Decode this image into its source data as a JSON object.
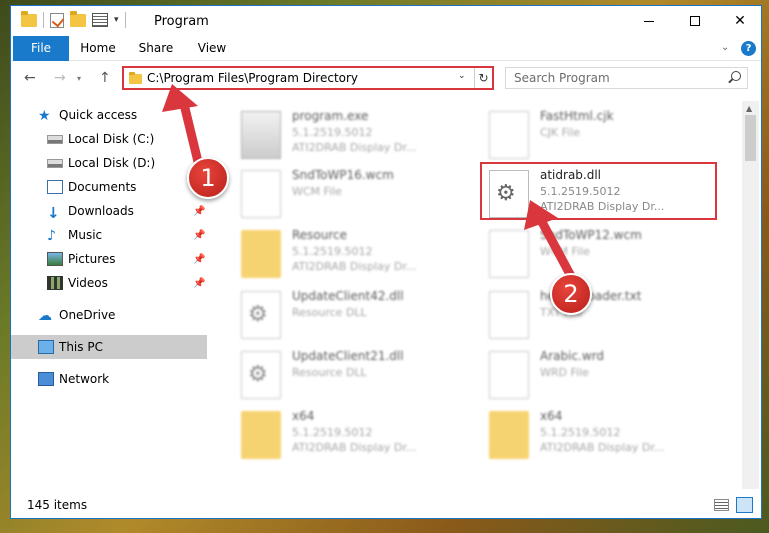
{
  "window": {
    "title": "Program",
    "controls": {
      "minimize": "",
      "maximize": "",
      "close": "✕"
    }
  },
  "ribbon": {
    "tabs": [
      "File",
      "Home",
      "Share",
      "View"
    ],
    "help": "?"
  },
  "nav": {
    "address": "C:\\Program Files\\Program Directory",
    "search_placeholder": "Search Program"
  },
  "sidebar": {
    "items": [
      {
        "label": "Quick access",
        "icon": "star-icon",
        "pinned": false
      },
      {
        "label": "Local Disk (C:)",
        "icon": "drive-icon",
        "pinned": false
      },
      {
        "label": "Local Disk (D:)",
        "icon": "drive-icon",
        "pinned": false
      },
      {
        "label": "Documents",
        "icon": "documents-icon",
        "pinned": false
      },
      {
        "label": "Downloads",
        "icon": "download-icon",
        "pinned": true
      },
      {
        "label": "Music",
        "icon": "music-icon",
        "pinned": true
      },
      {
        "label": "Pictures",
        "icon": "pictures-icon",
        "pinned": true
      },
      {
        "label": "Videos",
        "icon": "videos-icon",
        "pinned": true
      },
      {
        "label": "OneDrive",
        "icon": "cloud-icon",
        "pinned": false
      },
      {
        "label": "This PC",
        "icon": "computer-icon",
        "pinned": false,
        "selected": true
      },
      {
        "label": "Network",
        "icon": "network-icon",
        "pinned": false
      }
    ]
  },
  "files": [
    {
      "name": "program.exe",
      "line1": "5.1.2519.5012",
      "line2": "ATI2DRAB Display Dr...",
      "icon": "exe"
    },
    {
      "name": "FastHtml.cjk",
      "line1": "CJK File",
      "line2": "",
      "icon": "doc"
    },
    {
      "name": "SndToWP16.wcm",
      "line1": "WCM File",
      "line2": "",
      "icon": "doc"
    },
    {
      "name": "atidrab.dll",
      "line1": "5.1.2519.5012",
      "line2": "ATI2DRAB Display Dr...",
      "icon": "dll"
    },
    {
      "name": "Resource",
      "line1": "5.1.2519.5012",
      "line2": "ATI2DRAB Display Dr...",
      "icon": "folder"
    },
    {
      "name": "SndToWP12.wcm",
      "line1": "WCM File",
      "line2": "",
      "icon": "doc"
    },
    {
      "name": "UpdateClient42.dll",
      "line1": "Resource DLL",
      "line2": "",
      "icon": "dll"
    },
    {
      "name": "helper_loader.txt",
      "line1": "TXT File",
      "line2": "",
      "icon": "doc"
    },
    {
      "name": "UpdateClient21.dll",
      "line1": "Resource DLL",
      "line2": "",
      "icon": "dll"
    },
    {
      "name": "Arabic.wrd",
      "line1": "WRD File",
      "line2": "",
      "icon": "doc"
    },
    {
      "name": "x64",
      "line1": "5.1.2519.5012",
      "line2": "ATI2DRAB Display Dr...",
      "icon": "folder"
    },
    {
      "name": "x64",
      "line1": "5.1.2519.5012",
      "line2": "ATI2DRAB Display Dr...",
      "icon": "folder"
    }
  ],
  "status": {
    "count": "145 items"
  },
  "annotations": {
    "badge1": "1",
    "badge2": "2",
    "color": "#d9363e"
  }
}
